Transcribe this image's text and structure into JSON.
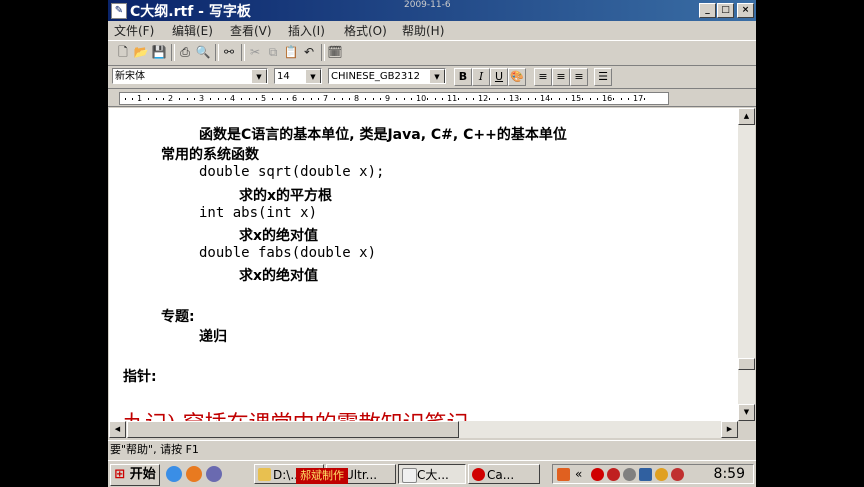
{
  "window": {
    "title": "C大纲.rtf - 写字板",
    "date_overlay": "2009-11-6",
    "controls": {
      "minimize": "_",
      "maximize": "□",
      "close": "×"
    }
  },
  "menu": {
    "items": [
      "文件(F)",
      "编辑(E)",
      "查看(V)",
      "插入(I)",
      "格式(O)",
      "帮助(H)"
    ]
  },
  "toolbar": {
    "icons": [
      "new-icon",
      "open-icon",
      "save-icon",
      "print-icon",
      "print-preview-icon",
      "find-icon",
      "cut-icon",
      "copy-icon",
      "paste-icon",
      "undo-icon",
      "datetime-icon"
    ]
  },
  "format_bar": {
    "font_name": "新宋体",
    "font_size": "14",
    "script": "CHINESE_GB2312",
    "bold": "B",
    "italic": "I",
    "underline": "U",
    "color": "color-icon"
  },
  "ruler": {
    "labels": [
      "1",
      "2",
      "3",
      "4",
      "5",
      "6",
      "7",
      "8",
      "9",
      "10",
      "11",
      "12",
      "13",
      "14",
      "15",
      "16",
      "17"
    ]
  },
  "document": {
    "lines": [
      {
        "text": "函数是C语言的基本单位, 类是Java, C#, C++的基本单位",
        "indent": 2,
        "style": "cjk"
      },
      {
        "text": "常用的系统函数",
        "indent": 1,
        "style": "cjk"
      },
      {
        "text": "double sqrt(double x);",
        "indent": 2,
        "style": "code"
      },
      {
        "text": "求的x的平方根",
        "indent": 3,
        "style": "cjk"
      },
      {
        "text": "int abs(int x)",
        "indent": 2,
        "style": "code"
      },
      {
        "text": "求x的绝对值",
        "indent": 3,
        "style": "cjk"
      },
      {
        "text": "double fabs(double x)",
        "indent": 2,
        "style": "code"
      },
      {
        "text": "求x的绝对值",
        "indent": 3,
        "style": "cjk"
      },
      {
        "text": "",
        "indent": 0,
        "style": "cjk"
      },
      {
        "text": "专题:",
        "indent": 1,
        "style": "cjk"
      },
      {
        "text": "递归",
        "indent": 2,
        "style": "cjk"
      },
      {
        "text": "",
        "indent": 0,
        "style": "cjk"
      },
      {
        "text": "指针:",
        "indent": 0,
        "style": "cjk"
      }
    ],
    "red_heading": "九记) 穿插在课堂中的零散知识笔记"
  },
  "status": {
    "text": "要\"帮助\", 请按 F1"
  },
  "taskbar": {
    "start_label": "开始",
    "tasks": [
      {
        "label": "D:\\...",
        "color": "#e8c050"
      },
      {
        "label": "Ultr...",
        "color": "#c0a000"
      },
      {
        "label": "C大...",
        "color": "#f0f0f0"
      },
      {
        "label": "Ca...",
        "color": "#d00000"
      }
    ],
    "clock": "8:59",
    "watermark": "郝斌制作"
  }
}
